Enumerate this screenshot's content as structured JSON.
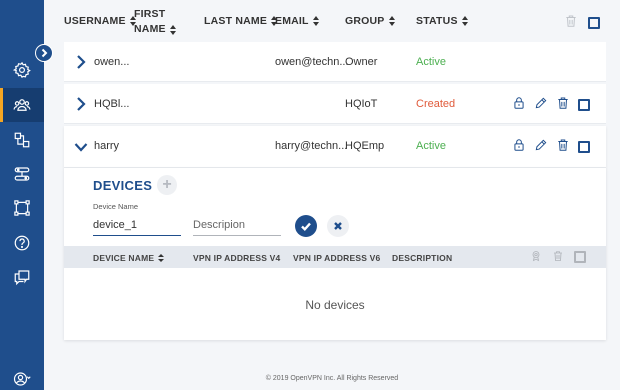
{
  "table": {
    "headers": {
      "username": "USERNAME",
      "first_name_line1": "FIRST",
      "first_name_line2": "NAME",
      "last_name": "LAST NAME",
      "email": "EMAIL",
      "group": "GROUP",
      "status": "STATUS"
    },
    "rows": [
      {
        "username": "owen...",
        "first_name": "",
        "last_name": "",
        "email": "owen@techn...",
        "group": "Owner",
        "status": "Active"
      },
      {
        "username": "HQBl...",
        "first_name": "",
        "last_name": "",
        "email": "",
        "group": "HQIoT",
        "status": "Created"
      },
      {
        "username": "harry",
        "first_name": "",
        "last_name": "",
        "email": "harry@techn...",
        "group": "HQEmp",
        "status": "Active"
      }
    ]
  },
  "devices": {
    "title": "DEVICES",
    "add_symbol": "+",
    "name_label": "Device Name",
    "name_value": "device_1",
    "description_placeholder": "Descripion",
    "headers": {
      "device_name": "DEVICE NAME",
      "vpn_ip_v4": "VPN IP ADDRESS V4",
      "vpn_ip_v6": "VPN IP ADDRESS V6",
      "description": "DESCRIPTION"
    },
    "empty_message": "No devices"
  },
  "footer": "© 2019 OpenVPN Inc. All Rights Reserved",
  "icons": {
    "sidebar": [
      "settings-icon",
      "users-icon",
      "network-icon",
      "routes-icon",
      "nodes-icon",
      "help-icon",
      "chat-icon",
      "account-icon"
    ],
    "row_actions": [
      "lock-icon",
      "edit-icon",
      "trash-icon"
    ]
  },
  "colors": {
    "brand": "#1f4e8c",
    "active": "#4caf50",
    "created": "#e05a3a"
  }
}
